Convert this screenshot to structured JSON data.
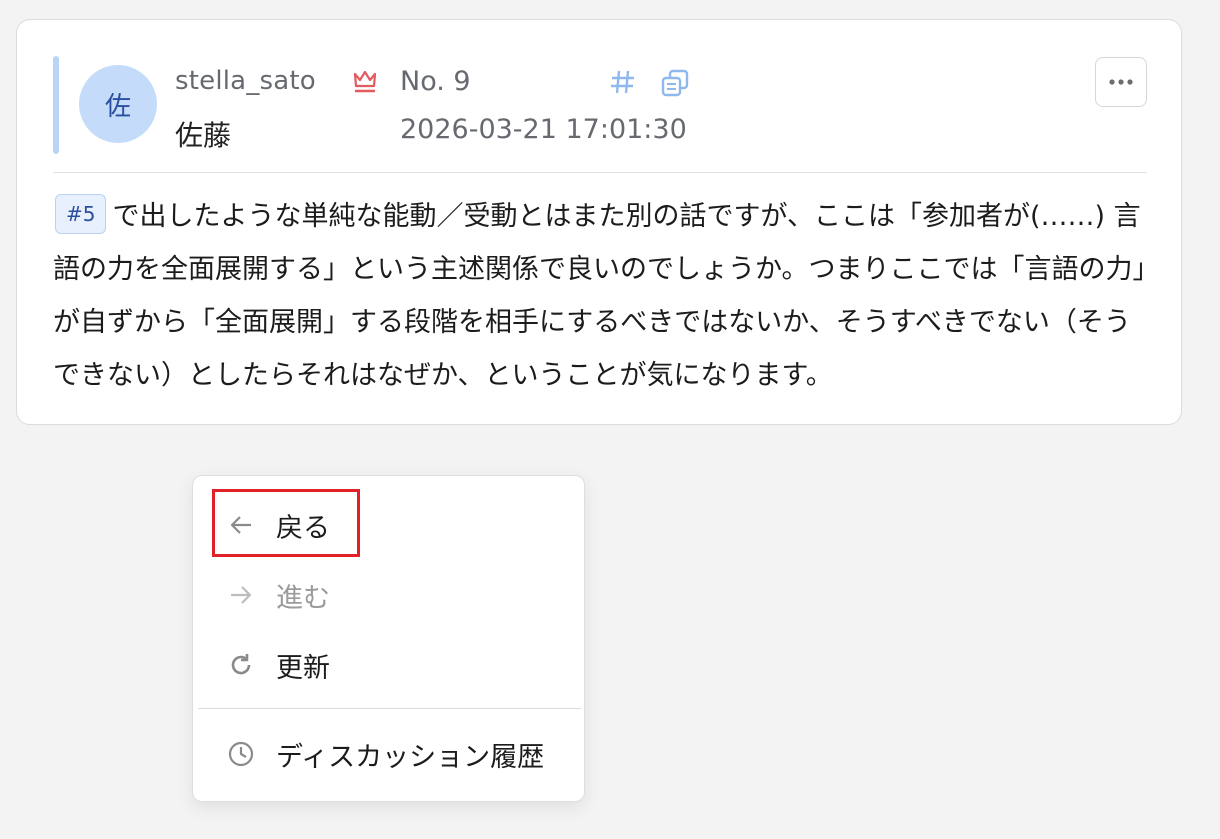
{
  "post": {
    "avatar_char": "佐",
    "username": "stella_sato",
    "display_name": "佐藤",
    "number": "No. 9",
    "timestamp": "2026-03-21 17:01:30",
    "reference_tag": "#5",
    "body_text": "で出したような単純な能動／受動とはまた別の話ですが、ここは「参加者が(……) 言語の力を全面展開する」という主述関係で良いのでしょうか。つまりここでは「言語の力」が自ずから「全面展開」する段階を相手にするべきではないか、そうすべきでない（そうできない）としたらそれはなぜか、ということが気になります。"
  },
  "icons": {
    "crown": "crown-icon",
    "hash": "hash-icon",
    "copy": "copy-icon",
    "more": "more-horizontal-icon"
  },
  "colors": {
    "crown": "#e35a5f",
    "accent_blue": "#8fb9ee",
    "avatar_bg": "#c4dcfa",
    "highlight": "#e02127"
  },
  "context_menu": {
    "items": [
      {
        "label": "戻る",
        "icon": "arrow-left-icon",
        "enabled": true
      },
      {
        "label": "進む",
        "icon": "arrow-right-icon",
        "enabled": false
      },
      {
        "label": "更新",
        "icon": "refresh-icon",
        "enabled": true
      },
      {
        "label": "ディスカッション履歴",
        "icon": "clock-icon",
        "enabled": true
      }
    ]
  }
}
